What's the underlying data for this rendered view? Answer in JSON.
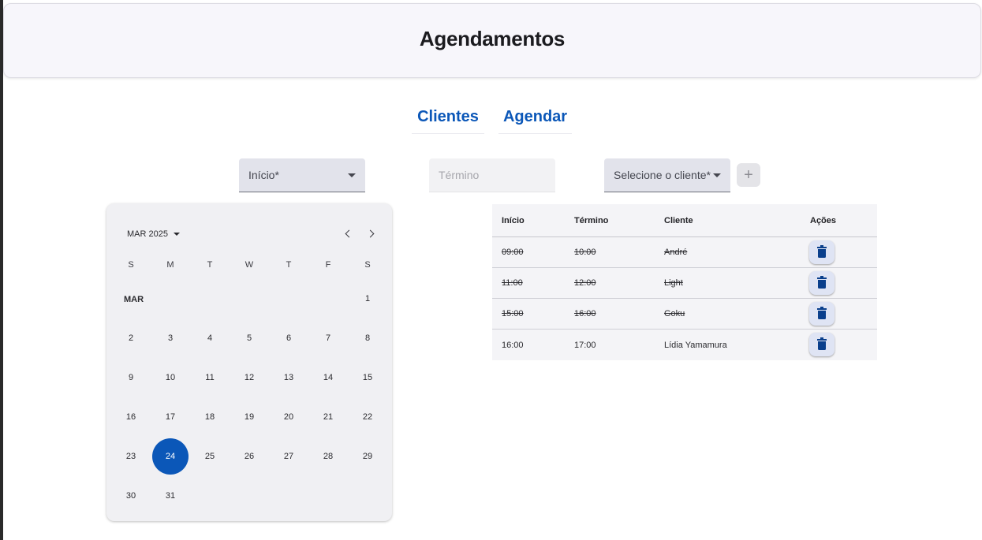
{
  "header": {
    "title": "Agendamentos"
  },
  "nav": {
    "clients_label": "Clientes",
    "schedule_label": "Agendar"
  },
  "form": {
    "start_label": "Início*",
    "end_placeholder": "Término",
    "client_label": "Selecione o cliente*",
    "add_label": "+"
  },
  "calendar": {
    "period_label": "MAR 2025",
    "month_label": "MAR",
    "weekdays": [
      "S",
      "M",
      "T",
      "W",
      "T",
      "F",
      "S"
    ],
    "selected_day": "24",
    "rows": [
      [
        "",
        "",
        "",
        "",
        "",
        "",
        "1"
      ],
      [
        "2",
        "3",
        "4",
        "5",
        "6",
        "7",
        "8"
      ],
      [
        "9",
        "10",
        "11",
        "12",
        "13",
        "14",
        "15"
      ],
      [
        "16",
        "17",
        "18",
        "19",
        "20",
        "21",
        "22"
      ],
      [
        "23",
        "24",
        "25",
        "26",
        "27",
        "28",
        "29"
      ],
      [
        "30",
        "31",
        "",
        "",
        "",
        "",
        ""
      ]
    ]
  },
  "table": {
    "headers": {
      "start": "Início",
      "end": "Término",
      "client": "Cliente",
      "actions": "Ações"
    },
    "rows": [
      {
        "start": "09:00",
        "end": "10:00",
        "client": "André",
        "struck": true
      },
      {
        "start": "11:00",
        "end": "12:00",
        "client": "Light",
        "struck": true
      },
      {
        "start": "15:00",
        "end": "16:00",
        "client": "Goku",
        "struck": true
      },
      {
        "start": "16:00",
        "end": "17:00",
        "client": "Lídia Yamamura",
        "struck": false
      }
    ]
  },
  "colors": {
    "accent": "#0b57b8",
    "trash_icon": "#0a3f8c",
    "header_bg": "#f7f6fb",
    "calendar_bg": "#f0f0f3"
  },
  "icons": {
    "dropdown": "caret-down-icon",
    "prev": "chevron-left-icon",
    "next": "chevron-right-icon",
    "add": "plus-icon",
    "delete": "trash-icon"
  }
}
